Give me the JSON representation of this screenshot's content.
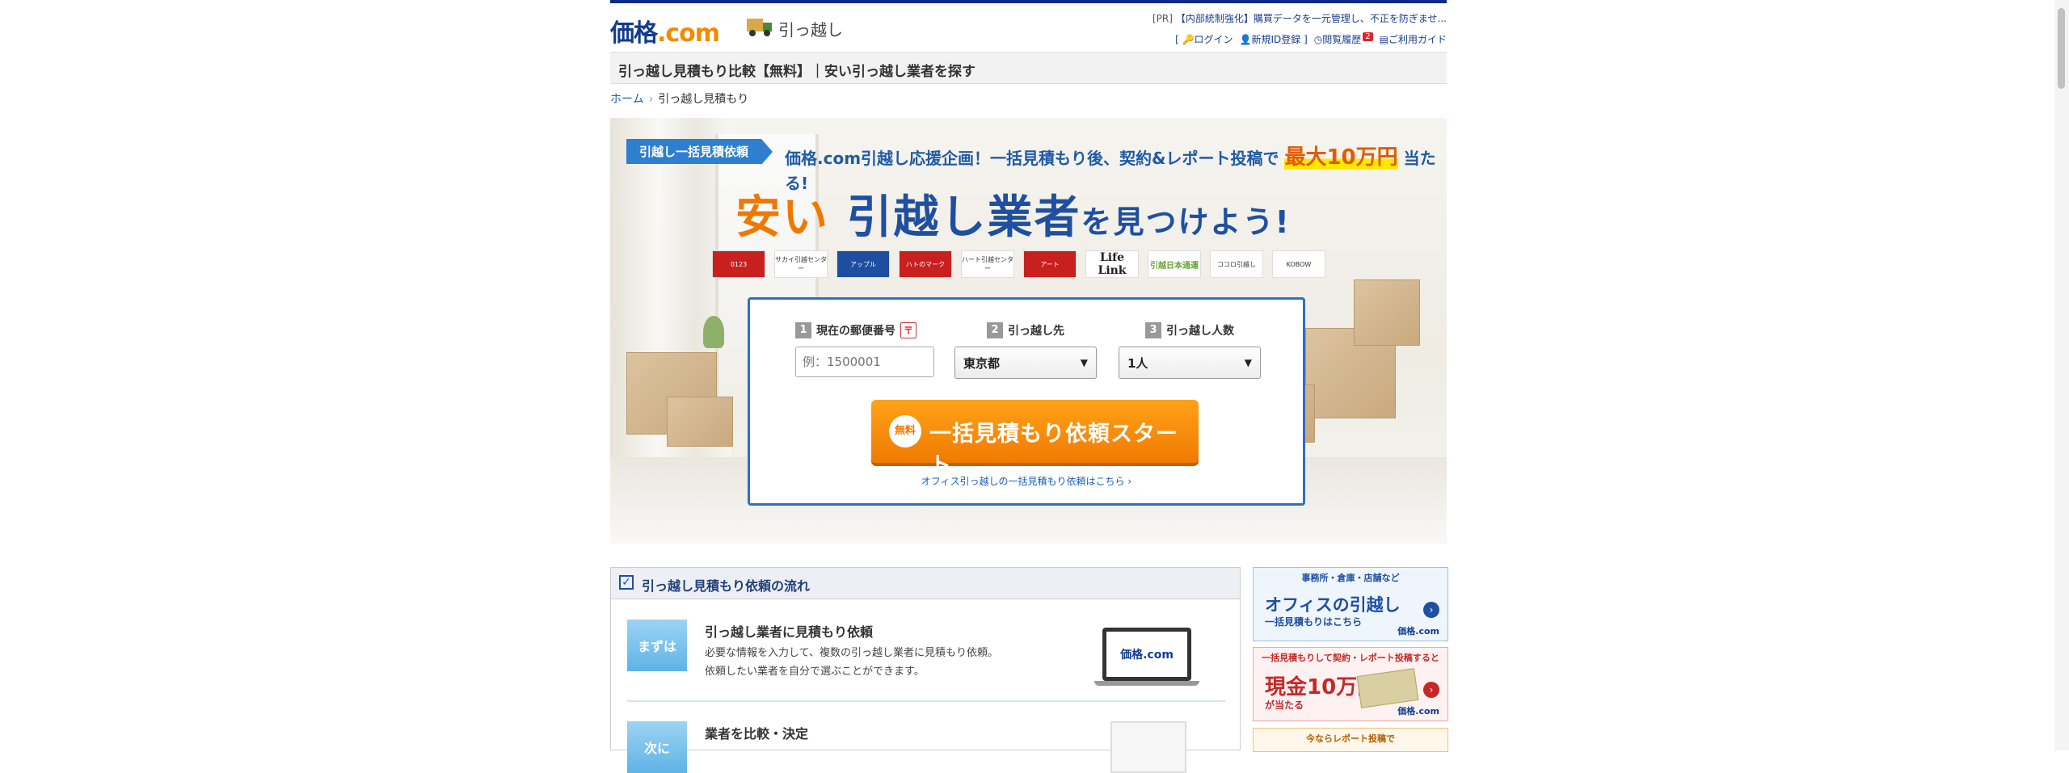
{
  "header": {
    "logo_text": "価格",
    "logo_dot": ".com",
    "section_name": "引っ越し",
    "pr_tag": "[PR]",
    "pr_text": "【内部統制強化】購買データを一元管理し、不正を防ぎませ...",
    "util": {
      "login": "ログイン",
      "register": "新規ID登録",
      "history": "閲覧履歴",
      "history_count": "2",
      "guide": "ご利用ガイド"
    }
  },
  "page_title": "引っ越し見積もり比較【無料】｜安い引っ越し業者を探す",
  "breadcrumb": {
    "home": "ホーム",
    "current": "引っ越し見積もり"
  },
  "hero": {
    "tag": "引越し一括見積依頼",
    "promo_prefix": "価格.com引越し応援企画！一括見積もり後、契約&レポート投稿で",
    "promo_highlight": "最大10万円",
    "promo_suffix": "当たる!",
    "headline_orange": "安い",
    "headline_blue": "引越し業者",
    "headline_small": "を見つけよう!",
    "company_logos": [
      "0123",
      "サカイ引越センター",
      "アップル",
      "ハトのマーク",
      "ハート引越センター",
      "アート",
      "Life Link",
      "引越日本通運",
      "ココロ引越し",
      "KOBOW"
    ]
  },
  "form": {
    "postal_num": "1",
    "postal_label": "現在の郵便番号",
    "postal_placeholder": "例：1500001",
    "dest_num": "2",
    "dest_label": "引っ越し先",
    "dest_value": "東京都",
    "people_num": "3",
    "people_label": "引っ越し人数",
    "people_value": "1人",
    "cta_free": "無料",
    "cta_label": "一括見積もり依頼スタート",
    "office_link": "オフィス引っ越しの一括見積もり依頼はこちら ›"
  },
  "flow": {
    "title": "引っ越し見積もり依頼の流れ",
    "steps": [
      {
        "badge": "まずは",
        "title": "引っ越し業者に見積もり依頼",
        "desc1": "必要な情報を入力して、複数の引っ越し業者に見積もり依頼。",
        "desc2": "依頼したい業者を自分で選ぶことができます。",
        "screen": "価格.com"
      },
      {
        "badge": "次に",
        "title": "業者を比較・決定"
      }
    ]
  },
  "side": {
    "office": {
      "top": "事務所・倉庫・店舗など",
      "big": "オフィスの引越し",
      "sub": "一括見積もりはこちら",
      "brand": "価格.com"
    },
    "prize": {
      "top": "一括見積もりして契約・レポート投稿すると",
      "big": "現金10万円",
      "sub": "が当たる",
      "brand": "価格.com"
    },
    "report": {
      "top": "今ならレポート投稿で"
    }
  }
}
